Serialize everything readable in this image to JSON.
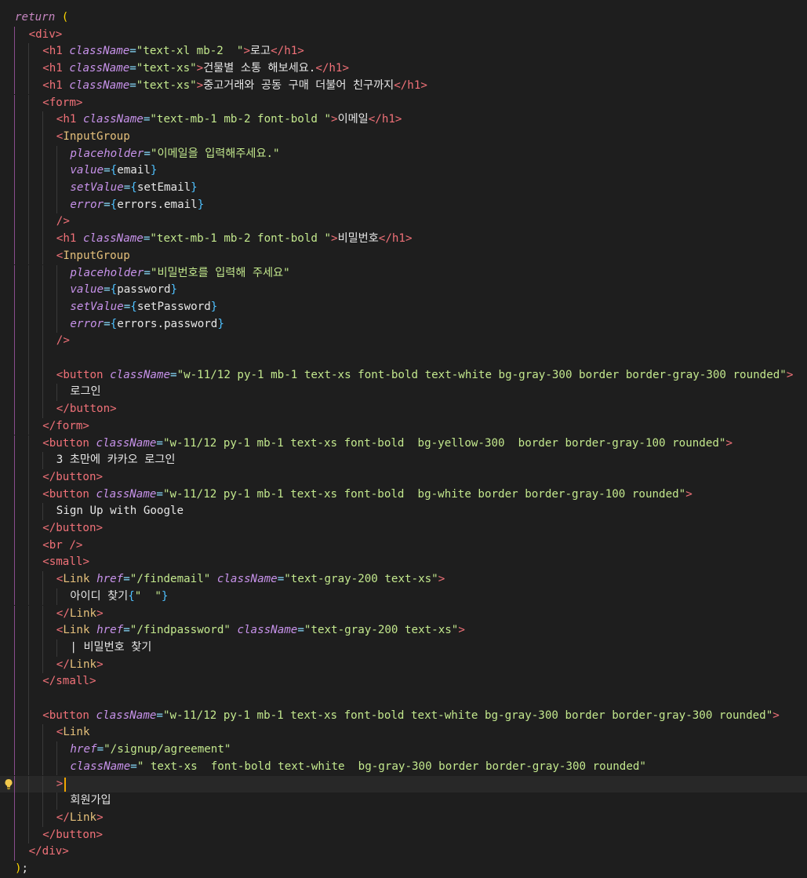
{
  "editor": {
    "language": "jsx",
    "theme_background": "#1e1e1e",
    "active_line": 45,
    "lines": [
      {
        "indent": 0,
        "tokens": [
          [
            "kw",
            "return"
          ],
          [
            "plain",
            " "
          ],
          [
            "brk",
            "("
          ]
        ]
      },
      {
        "indent": 1,
        "tokens": [
          [
            "tag",
            "<div"
          ],
          [
            "tag",
            ">"
          ]
        ]
      },
      {
        "indent": 2,
        "tokens": [
          [
            "tag",
            "<h1"
          ],
          [
            "plain",
            " "
          ],
          [
            "attr",
            "className"
          ],
          [
            "pun",
            "="
          ],
          [
            "str",
            "\"text-xl mb-2  \""
          ],
          [
            "tag",
            ">"
          ],
          [
            "txt",
            "로고"
          ],
          [
            "tag",
            "</h1>"
          ]
        ]
      },
      {
        "indent": 2,
        "tokens": [
          [
            "tag",
            "<h1"
          ],
          [
            "plain",
            " "
          ],
          [
            "attr",
            "className"
          ],
          [
            "pun",
            "="
          ],
          [
            "str",
            "\"text-xs\""
          ],
          [
            "tag",
            ">"
          ],
          [
            "txt",
            "건물별 소통 해보세요."
          ],
          [
            "tag",
            "</h1>"
          ]
        ]
      },
      {
        "indent": 2,
        "tokens": [
          [
            "tag",
            "<h1"
          ],
          [
            "plain",
            " "
          ],
          [
            "attr",
            "className"
          ],
          [
            "pun",
            "="
          ],
          [
            "str",
            "\"text-xs\""
          ],
          [
            "tag",
            ">"
          ],
          [
            "txt",
            "중고거래와 공동 구매 더불어 친구까지"
          ],
          [
            "tag",
            "</h1>"
          ]
        ]
      },
      {
        "indent": 2,
        "tokens": [
          [
            "tag",
            "<form"
          ],
          [
            "tag",
            ">"
          ]
        ]
      },
      {
        "indent": 3,
        "tokens": [
          [
            "tag",
            "<h1"
          ],
          [
            "plain",
            " "
          ],
          [
            "attr",
            "className"
          ],
          [
            "pun",
            "="
          ],
          [
            "str",
            "\"text-mb-1 mb-2 font-bold \""
          ],
          [
            "tag",
            ">"
          ],
          [
            "txt",
            "이메일"
          ],
          [
            "tag",
            "</h1>"
          ]
        ]
      },
      {
        "indent": 3,
        "tokens": [
          [
            "tag",
            "<"
          ],
          [
            "comp",
            "InputGroup"
          ]
        ]
      },
      {
        "indent": 4,
        "tokens": [
          [
            "attr",
            "placeholder"
          ],
          [
            "pun",
            "="
          ],
          [
            "str",
            "\"이메일을 입력해주세요.\""
          ]
        ]
      },
      {
        "indent": 4,
        "tokens": [
          [
            "attr",
            "value"
          ],
          [
            "pun",
            "="
          ],
          [
            "brk2",
            "{"
          ],
          [
            "plain",
            "email"
          ],
          [
            "brk2",
            "}"
          ]
        ]
      },
      {
        "indent": 4,
        "tokens": [
          [
            "attr",
            "setValue"
          ],
          [
            "pun",
            "="
          ],
          [
            "brk2",
            "{"
          ],
          [
            "plain",
            "setEmail"
          ],
          [
            "brk2",
            "}"
          ]
        ]
      },
      {
        "indent": 4,
        "tokens": [
          [
            "attr",
            "error"
          ],
          [
            "pun",
            "="
          ],
          [
            "brk2",
            "{"
          ],
          [
            "plain",
            "errors.email"
          ],
          [
            "brk2",
            "}"
          ]
        ]
      },
      {
        "indent": 3,
        "tokens": [
          [
            "tag",
            "/>"
          ]
        ]
      },
      {
        "indent": 3,
        "tokens": [
          [
            "tag",
            "<h1"
          ],
          [
            "plain",
            " "
          ],
          [
            "attr",
            "className"
          ],
          [
            "pun",
            "="
          ],
          [
            "str",
            "\"text-mb-1 mb-2 font-bold \""
          ],
          [
            "tag",
            ">"
          ],
          [
            "txt",
            "비밀번호"
          ],
          [
            "tag",
            "</h1>"
          ]
        ]
      },
      {
        "indent": 3,
        "tokens": [
          [
            "tag",
            "<"
          ],
          [
            "comp",
            "InputGroup"
          ]
        ]
      },
      {
        "indent": 4,
        "tokens": [
          [
            "attr",
            "placeholder"
          ],
          [
            "pun",
            "="
          ],
          [
            "str",
            "\"비밀번호를 입력해 주세요\""
          ]
        ]
      },
      {
        "indent": 4,
        "tokens": [
          [
            "attr",
            "value"
          ],
          [
            "pun",
            "="
          ],
          [
            "brk2",
            "{"
          ],
          [
            "plain",
            "password"
          ],
          [
            "brk2",
            "}"
          ]
        ]
      },
      {
        "indent": 4,
        "tokens": [
          [
            "attr",
            "setValue"
          ],
          [
            "pun",
            "="
          ],
          [
            "brk2",
            "{"
          ],
          [
            "plain",
            "setPassword"
          ],
          [
            "brk2",
            "}"
          ]
        ]
      },
      {
        "indent": 4,
        "tokens": [
          [
            "attr",
            "error"
          ],
          [
            "pun",
            "="
          ],
          [
            "brk2",
            "{"
          ],
          [
            "plain",
            "errors.password"
          ],
          [
            "brk2",
            "}"
          ]
        ]
      },
      {
        "indent": 3,
        "tokens": [
          [
            "tag",
            "/>"
          ]
        ]
      },
      {
        "indent": 3,
        "tokens": []
      },
      {
        "indent": 3,
        "tokens": [
          [
            "tag",
            "<button"
          ],
          [
            "plain",
            " "
          ],
          [
            "attr",
            "className"
          ],
          [
            "pun",
            "="
          ],
          [
            "str",
            "\"w-11/12 py-1 mb-1 text-xs font-bold text-white bg-gray-300 border border-gray-300 rounded\""
          ],
          [
            "tag",
            ">"
          ]
        ]
      },
      {
        "indent": 4,
        "tokens": [
          [
            "txt",
            "로그인"
          ]
        ]
      },
      {
        "indent": 3,
        "tokens": [
          [
            "tag",
            "</button>"
          ]
        ]
      },
      {
        "indent": 2,
        "tokens": [
          [
            "tag",
            "</form>"
          ]
        ]
      },
      {
        "indent": 2,
        "tokens": [
          [
            "tag",
            "<button"
          ],
          [
            "plain",
            " "
          ],
          [
            "attr",
            "className"
          ],
          [
            "pun",
            "="
          ],
          [
            "str",
            "\"w-11/12 py-1 mb-1 text-xs font-bold  bg-yellow-300  border border-gray-100 rounded\""
          ],
          [
            "tag",
            ">"
          ]
        ]
      },
      {
        "indent": 3,
        "tokens": [
          [
            "txt",
            "3 초만에 카카오 로그인"
          ]
        ]
      },
      {
        "indent": 2,
        "tokens": [
          [
            "tag",
            "</button>"
          ]
        ]
      },
      {
        "indent": 2,
        "tokens": [
          [
            "tag",
            "<button"
          ],
          [
            "plain",
            " "
          ],
          [
            "attr",
            "className"
          ],
          [
            "pun",
            "="
          ],
          [
            "str",
            "\"w-11/12 py-1 mb-1 text-xs font-bold  bg-white border border-gray-100 rounded\""
          ],
          [
            "tag",
            ">"
          ]
        ]
      },
      {
        "indent": 3,
        "tokens": [
          [
            "txt",
            "Sign Up with Google"
          ]
        ]
      },
      {
        "indent": 2,
        "tokens": [
          [
            "tag",
            "</button>"
          ]
        ]
      },
      {
        "indent": 2,
        "tokens": [
          [
            "tag",
            "<br"
          ],
          [
            "plain",
            " "
          ],
          [
            "tag",
            "/>"
          ]
        ]
      },
      {
        "indent": 2,
        "tokens": [
          [
            "tag",
            "<small"
          ],
          [
            "tag",
            ">"
          ]
        ]
      },
      {
        "indent": 3,
        "tokens": [
          [
            "tag",
            "<"
          ],
          [
            "comp",
            "Link"
          ],
          [
            "plain",
            " "
          ],
          [
            "attr",
            "href"
          ],
          [
            "pun",
            "="
          ],
          [
            "str",
            "\"/findemail\""
          ],
          [
            "plain",
            " "
          ],
          [
            "attr",
            "className"
          ],
          [
            "pun",
            "="
          ],
          [
            "str",
            "\"text-gray-200 text-xs\""
          ],
          [
            "tag",
            ">"
          ]
        ]
      },
      {
        "indent": 4,
        "tokens": [
          [
            "txt",
            "아이디 찾기"
          ],
          [
            "brk2",
            "{"
          ],
          [
            "str",
            "\"  \""
          ],
          [
            "brk2",
            "}"
          ]
        ]
      },
      {
        "indent": 3,
        "tokens": [
          [
            "tag",
            "</"
          ],
          [
            "comp",
            "Link"
          ],
          [
            "tag",
            ">"
          ]
        ]
      },
      {
        "indent": 3,
        "tokens": [
          [
            "tag",
            "<"
          ],
          [
            "comp",
            "Link"
          ],
          [
            "plain",
            " "
          ],
          [
            "attr",
            "href"
          ],
          [
            "pun",
            "="
          ],
          [
            "str",
            "\"/findpassword\""
          ],
          [
            "plain",
            " "
          ],
          [
            "attr",
            "className"
          ],
          [
            "pun",
            "="
          ],
          [
            "str",
            "\"text-gray-200 text-xs\""
          ],
          [
            "tag",
            ">"
          ]
        ]
      },
      {
        "indent": 4,
        "tokens": [
          [
            "txt",
            "| 비밀번호 찾기"
          ]
        ]
      },
      {
        "indent": 3,
        "tokens": [
          [
            "tag",
            "</"
          ],
          [
            "comp",
            "Link"
          ],
          [
            "tag",
            ">"
          ]
        ]
      },
      {
        "indent": 2,
        "tokens": [
          [
            "tag",
            "</small>"
          ]
        ]
      },
      {
        "indent": 2,
        "tokens": []
      },
      {
        "indent": 2,
        "tokens": [
          [
            "tag",
            "<button"
          ],
          [
            "plain",
            " "
          ],
          [
            "attr",
            "className"
          ],
          [
            "pun",
            "="
          ],
          [
            "str",
            "\"w-11/12 py-1 mb-1 text-xs font-bold text-white bg-gray-300 border border-gray-300 rounded\""
          ],
          [
            "tag",
            ">"
          ]
        ]
      },
      {
        "indent": 3,
        "tokens": [
          [
            "tag",
            "<"
          ],
          [
            "comp",
            "Link"
          ]
        ]
      },
      {
        "indent": 4,
        "tokens": [
          [
            "attr",
            "href"
          ],
          [
            "pun",
            "="
          ],
          [
            "str",
            "\"/signup/agreement\""
          ]
        ]
      },
      {
        "indent": 4,
        "tokens": [
          [
            "attr",
            "className"
          ],
          [
            "pun",
            "="
          ],
          [
            "str",
            "\" text-xs  font-bold text-white  bg-gray-300 border border-gray-300 rounded\""
          ]
        ]
      },
      {
        "indent": 3,
        "tokens": [
          [
            "tag",
            ">"
          ]
        ]
      },
      {
        "indent": 4,
        "tokens": [
          [
            "txt",
            "회원가입"
          ]
        ]
      },
      {
        "indent": 3,
        "tokens": [
          [
            "tag",
            "</"
          ],
          [
            "comp",
            "Link"
          ],
          [
            "tag",
            ">"
          ]
        ]
      },
      {
        "indent": 2,
        "tokens": [
          [
            "tag",
            "</button>"
          ]
        ]
      },
      {
        "indent": 1,
        "tokens": [
          [
            "tag",
            "</div>"
          ]
        ]
      },
      {
        "indent": 0,
        "tokens": [
          [
            "brk",
            ")"
          ],
          [
            "plain",
            ";"
          ]
        ]
      }
    ]
  }
}
